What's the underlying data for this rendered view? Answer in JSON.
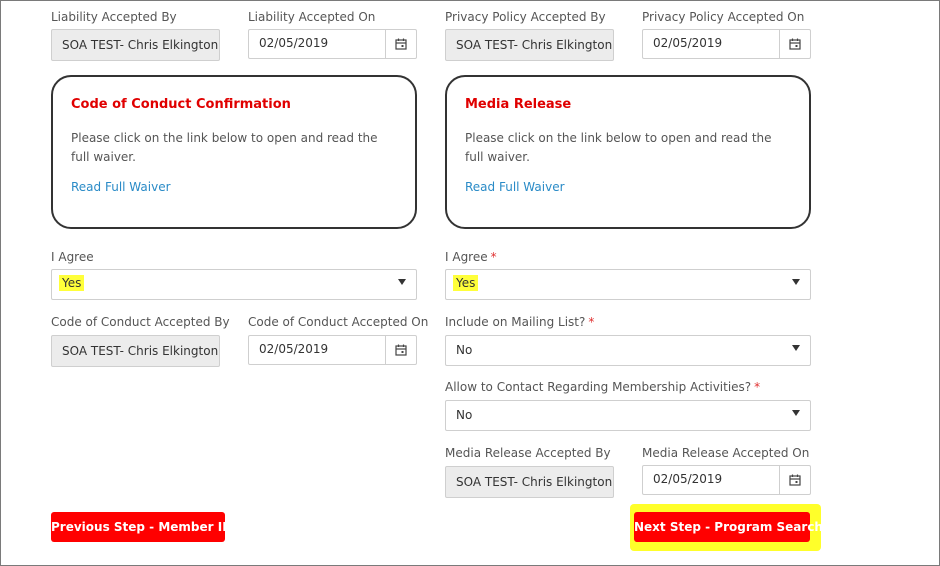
{
  "left": {
    "liability_by_label": "Liability Accepted By",
    "liability_by_value": "SOA TEST- Chris Elkington",
    "liability_on_label": "Liability Accepted On",
    "liability_on_value": "02/05/2019",
    "card_title": "Code of Conduct Confirmation",
    "card_body": "Please click on the link below to open and read the full waiver.",
    "card_link": "Read Full Waiver",
    "agree_label": "I Agree",
    "agree_value": "Yes",
    "coc_by_label": "Code of Conduct Accepted By",
    "coc_by_value": "SOA TEST- Chris Elkington",
    "coc_on_label": "Code of Conduct Accepted On",
    "coc_on_value": "02/05/2019"
  },
  "right": {
    "privacy_by_label": "Privacy Policy Accepted By",
    "privacy_by_value": "SOA TEST- Chris Elkington",
    "privacy_on_label": "Privacy Policy Accepted On",
    "privacy_on_value": "02/05/2019",
    "card_title": "Media Release",
    "card_body": "Please click on the link below to open and read the full waiver.",
    "card_link": "Read Full Waiver",
    "agree_label": "I Agree",
    "agree_value": "Yes",
    "mailing_label": "Include on Mailing List?",
    "mailing_value": "No",
    "contact_label": "Allow to Contact Regarding Membership Activities?",
    "contact_value": "No",
    "media_by_label": "Media Release Accepted By",
    "media_by_value": "SOA TEST- Chris Elkington",
    "media_on_label": "Media Release Accepted On",
    "media_on_value": "02/05/2019"
  },
  "required_marker": "*",
  "buttons": {
    "previous": "Previous Step - Member ID",
    "next": "Next Step - Program Search"
  },
  "colors": {
    "accent": "#ff0000",
    "card_title": "#e00000",
    "link": "#2a8bc7",
    "highlight": "#ffff2a"
  }
}
